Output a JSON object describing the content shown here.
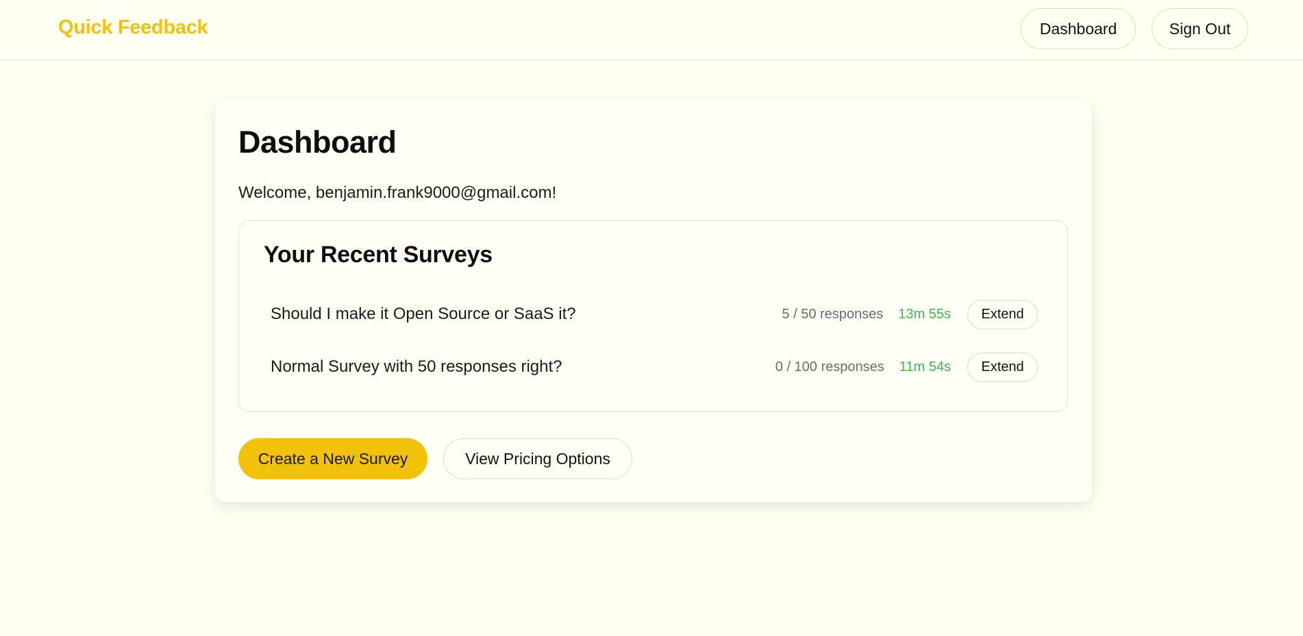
{
  "header": {
    "brand": "Quick Feedback",
    "nav": {
      "dashboard_label": "Dashboard",
      "signout_label": "Sign Out"
    }
  },
  "main": {
    "title": "Dashboard",
    "welcome": "Welcome, benjamin.frank9000@gmail.com!",
    "recent_surveys": {
      "title": "Your Recent Surveys",
      "items": [
        {
          "name": "Should I make it Open Source or SaaS it?",
          "responses": "5 / 50 responses",
          "time_left": "13m 55s",
          "extend_label": "Extend"
        },
        {
          "name": "Normal Survey with 50 responses right?",
          "responses": "0 / 100 responses",
          "time_left": "11m 54s",
          "extend_label": "Extend"
        }
      ]
    },
    "actions": {
      "create_label": "Create a New Survey",
      "pricing_label": "View Pricing Options"
    }
  },
  "colors": {
    "brand": "#f2c10a",
    "background": "#fffff2",
    "timer": "#3cba4e"
  }
}
